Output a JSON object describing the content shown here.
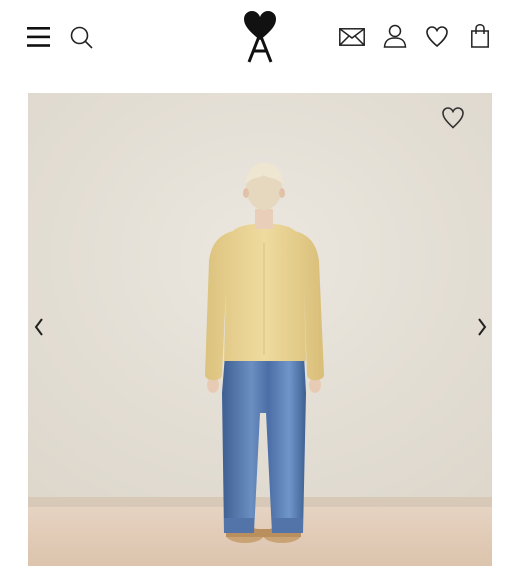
{
  "header": {
    "menu_icon": "hamburger-menu-icon",
    "search_icon": "search-icon",
    "logo": "ami-heart-logo",
    "contact_icon": "envelope-icon",
    "account_icon": "user-icon",
    "wishlist_icon": "heart-icon",
    "bag_icon": "shopping-bag-icon"
  },
  "product": {
    "wishlist_icon": "heart-outline-icon",
    "prev_icon": "chevron-left-icon",
    "next_icon": "chevron-right-icon"
  },
  "colors": {
    "icon": "#1a1a1a",
    "wall": "#e5e0d6",
    "floor": "#e2cbb6",
    "sweater": "#ecd698",
    "jeans": "#5a7fb4"
  }
}
